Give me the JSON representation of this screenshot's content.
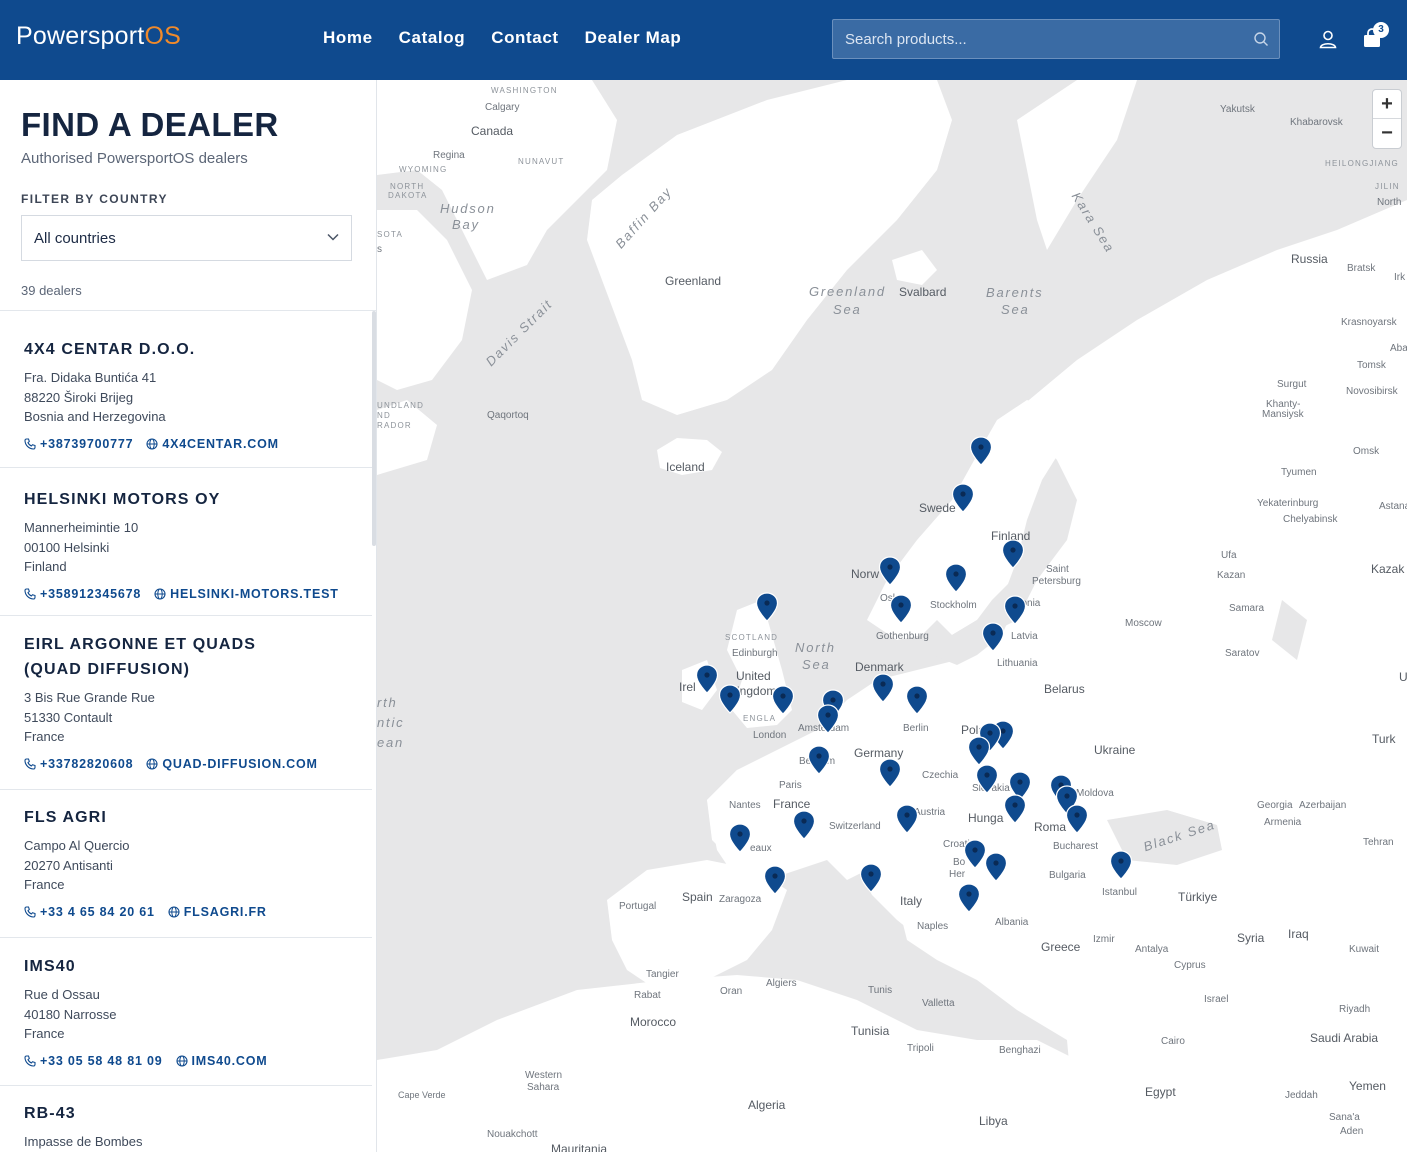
{
  "header": {
    "logo_main": "Powersport",
    "logo_accent": "OS",
    "nav": [
      "Home",
      "Catalog",
      "Contact",
      "Dealer Map"
    ],
    "search_placeholder": "Search products...",
    "cart_count": "3"
  },
  "sidebar": {
    "title": "FIND A DEALER",
    "subtitle": "Authorised PowersportOS dealers",
    "filter_label": "FILTER BY COUNTRY",
    "filter_value": "All countries",
    "count": "39 dealers",
    "dealers": [
      {
        "name": "4X4 CENTAR D.O.O.",
        "address": [
          "Fra. Didaka Buntića 41",
          "88220 Široki Brijeg",
          "Bosnia and Herzegovina"
        ],
        "phone": "+38739700777",
        "web": "4X4CENTAR.COM"
      },
      {
        "name": "HELSINKI MOTORS OY",
        "address": [
          "Mannerheimintie 10",
          "00100 Helsinki",
          "Finland"
        ],
        "phone": "+358912345678",
        "web": "HELSINKI-MOTORS.TEST"
      },
      {
        "name": "EIRL ARGONNE ET QUADS (QUAD DIFFUSION)",
        "address": [
          "3 Bis Rue Grande Rue",
          "51330 Contault",
          "France"
        ],
        "phone": "+33782820608",
        "web": "QUAD-DIFFUSION.COM"
      },
      {
        "name": "FLS AGRI",
        "address": [
          "Campo Al Quercio",
          "20270 Antisanti",
          "France"
        ],
        "phone": "+33 4 65 84 20 61",
        "web": "FLSAGRI.FR"
      },
      {
        "name": "IMS40",
        "address": [
          "Rue d Ossau",
          "40180 Narrosse",
          "France"
        ],
        "phone": "+33 05 58 48 81 09",
        "web": "IMS40.COM"
      },
      {
        "name": "RB-43",
        "address": [
          "Impasse de Bombes"
        ],
        "phone": "",
        "web": ""
      }
    ]
  },
  "map": {
    "zoom_in": "+",
    "zoom_out": "−",
    "labels": {
      "washington": "WASHINGTON",
      "calgary": "Calgary",
      "canada": "Canada",
      "regina": "Regina",
      "nunavut": "NUNAVUT",
      "wyoming": "WYOMING",
      "north": "NORTH",
      "dakota": "DAKOTA",
      "sota": "SOTA",
      "s": "s",
      "hudson1": "Hudson",
      "hudson2": "Bay",
      "baffin": "Baffin Bay",
      "greenland": "Greenland",
      "davis": "Davis Strait",
      "undland1": "UNDLAND",
      "undland2": "ND",
      "undland3": "RADOR",
      "qaqortoq": "Qaqortoq",
      "greensea1": "Greenland",
      "greensea2": "Sea",
      "svalbard": "Svalbard",
      "barents1": "Barents",
      "barents2": "Sea",
      "kara": "Kara Sea",
      "yakutsk": "Yakutsk",
      "khabarovsk": "Khabarovsk",
      "heilong": "HEILONGJIANG",
      "jilin": "JILIN",
      "northc": "North",
      "russia": "Russia",
      "bratsk": "Bratsk",
      "irk": "Irk",
      "krasnoyarsk": "Krasnoyarsk",
      "abal": "Abal",
      "tomsk": "Tomsk",
      "surgut": "Surgut",
      "novosibirsk": "Novosibirsk",
      "khanty1": "Khanty-",
      "khanty2": "Mansiysk",
      "omsk": "Omsk",
      "tyumen": "Tyumen",
      "yekat": "Yekaterinburg",
      "chely": "Chelyabinsk",
      "astana": "Astana",
      "ufa": "Ufa",
      "kazak": "Kazak",
      "kazan": "Kazan",
      "samara": "Samara",
      "saratov": "Saratov",
      "moscow": "Moscow",
      "u": "U",
      "iceland": "Iceland",
      "sweden": "Swede",
      "finland": "Finland",
      "saint1": "Saint",
      "saint2": "Petersburg",
      "norway": "Norw",
      "oslo": "Oslo",
      "stockholm": "Stockholm",
      "estonia": "Estonia",
      "latvia": "Latvia",
      "lithuania": "Lithuania",
      "gothenburg": "Gothenburg",
      "scotland": "SCOTLAND",
      "edinburgh": "Edinburgh",
      "northsea1": "North",
      "northsea2": "Sea",
      "denmark": "Denmark",
      "uk1": "United",
      "uk2": "Kingdom",
      "ireland": "Irel",
      "belarus": "Belarus",
      "england": "ENGLA",
      "london": "London",
      "amsterdam": "Amsterdam",
      "berlin": "Berlin",
      "poland": "Poland",
      "ukraine": "Ukraine",
      "turk": "Turk",
      "atl1": "rth",
      "atl2": "ntic",
      "atl3": "ean",
      "germany": "Germany",
      "belgium": "Belgium",
      "paris": "Paris",
      "czechia": "Czechia",
      "slovakia": "Slovakia",
      "france": "France",
      "nantes": "Nantes",
      "austria": "Austria",
      "moldova": "Moldova",
      "georgia": "Georgia",
      "azerbaijan": "Azerbaijan",
      "armenia": "Armenia",
      "switzerland": "Switzerland",
      "hungary": "Hunga",
      "romania": "Roma",
      "croatia": "Croatia",
      "bucharest": "Bucharest",
      "blacksea": "Black Sea",
      "tehran": "Tehran",
      "bordeaux": "eaux",
      "bosnia1": "Bo",
      "bosnia2": "Her",
      "serbia": "nd",
      "bulgaria": "Bulgaria",
      "istanbul": "Istanbul",
      "turkiye": "Türkiye",
      "portugal": "Portugal",
      "spain": "Spain",
      "zaragoza": "Zaragoza",
      "italy": "Italy",
      "albania": "Albania",
      "naples": "Naples",
      "greece": "Greece",
      "izmir": "Izmir",
      "antalya": "Antalya",
      "syria": "Syria",
      "iraq": "Iraq",
      "kuwait": "Kuwait",
      "cyprus": "Cyprus",
      "tangier": "Tangier",
      "rabat": "Rabat",
      "oran": "Oran",
      "algiers": "Algiers",
      "tunis": "Tunis",
      "valletta": "Valletta",
      "israel": "Israel",
      "riyadh": "Riyadh",
      "morocco": "Morocco",
      "tunisia": "Tunisia",
      "tripoli": "Tripoli",
      "benghazi": "Benghazi",
      "cairo": "Cairo",
      "saudi": "Saudi Arabia",
      "ws1": "Western",
      "ws2": "Sahara",
      "capeverde": "Cape Verde",
      "egypt": "Egypt",
      "yemen": "Yemen",
      "algeria": "Algeria",
      "jeddah": "Jeddah",
      "libya": "Libya",
      "sanaa": "Sana'a",
      "aden": "Aden",
      "nouakchott": "Nouakchott",
      "mauritania": "Mauritania"
    }
  }
}
